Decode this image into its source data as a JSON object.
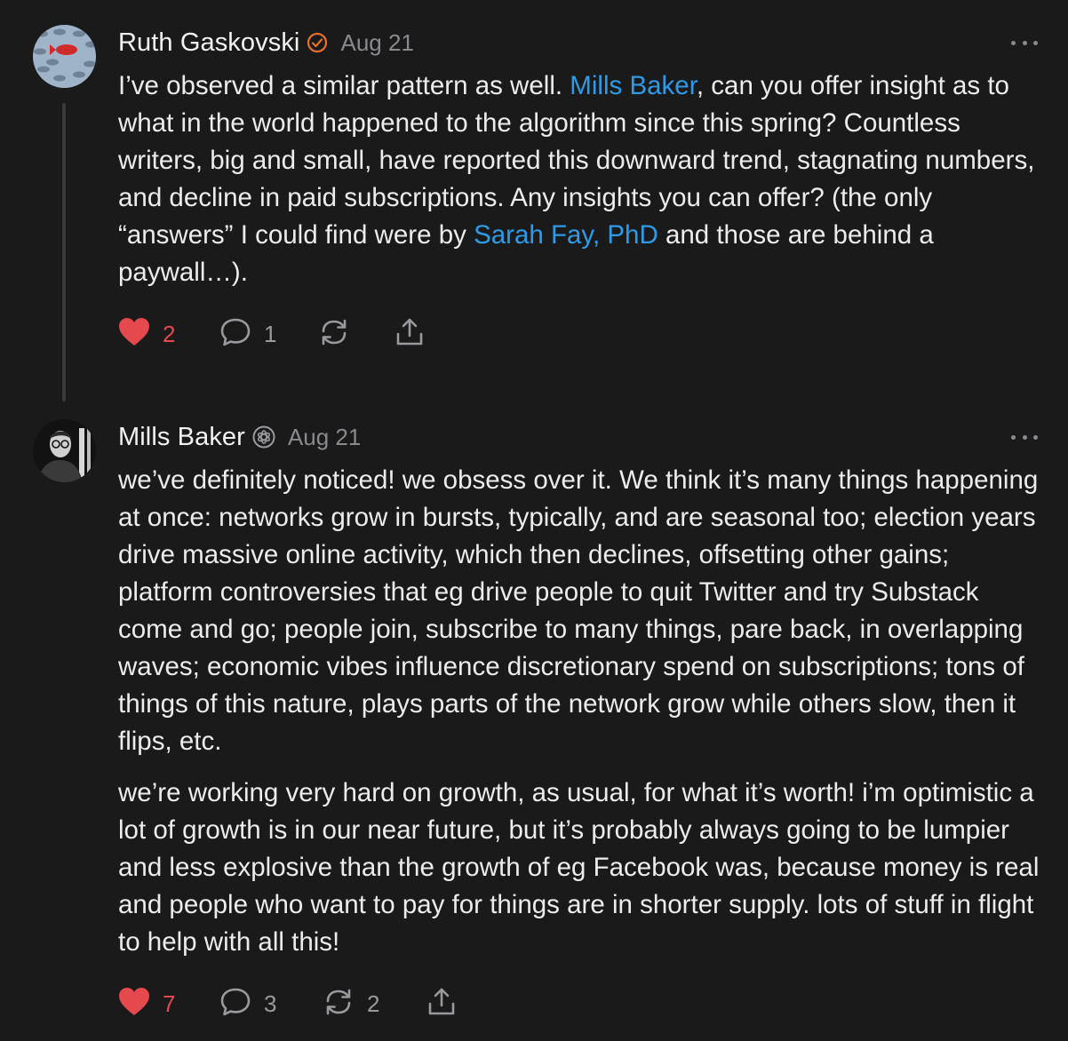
{
  "comments": [
    {
      "author": "Ruth Gaskovski",
      "badge_icon": "orange-check-circle-icon",
      "date": "Aug 21",
      "body": {
        "p1_a": "I’ve observed a similar pattern as well. ",
        "mention1": "Mills Baker",
        "p1_b": ", can you offer insight as to what in the world happened to the algorithm since this spring? Countless writers, big and small, have reported this downward trend, stagnating numbers, and decline in paid subscriptions. Any insights you can offer? (the only “answers” I could find were by ",
        "mention2": "Sarah Fay, PhD",
        "p1_c": " and those are behind a paywall…)."
      },
      "likes": "2",
      "replies": "1",
      "restacks": "",
      "liked": true
    },
    {
      "author": "Mills Baker",
      "badge_icon": "substack-staff-badge-icon",
      "date": "Aug 21",
      "body": {
        "p1": "we’ve definitely noticed! we obsess over it. We think it’s many things happening at once: networks grow in bursts, typically, and are seasonal too; election years drive massive online activity, which then declines, offsetting other gains; platform controversies that eg drive people to quit Twitter and try Substack come and go; people join, subscribe to many things, pare back, in overlapping waves; economic vibes influence discretionary spend on subscriptions; tons of things of this nature, plays parts of the network grow while others slow, then it flips, etc.",
        "p2": "we’re working very hard on growth, as usual, for what it’s worth! i’m optimistic a lot of growth is in our near future, but it’s probably always going to be lumpier and less explosive than the growth of eg Facebook was, because money is real and people who want to pay for things are in shorter supply. lots of stuff in flight to help with all this!"
      },
      "likes": "7",
      "replies": "3",
      "restacks": "2",
      "liked": true
    }
  ],
  "colors": {
    "background": "#1a1a1b",
    "text": "#ececec",
    "muted": "#8a8a8e",
    "mention": "#2f9be6",
    "like": "#e5484d",
    "verified": "#e8702a"
  }
}
